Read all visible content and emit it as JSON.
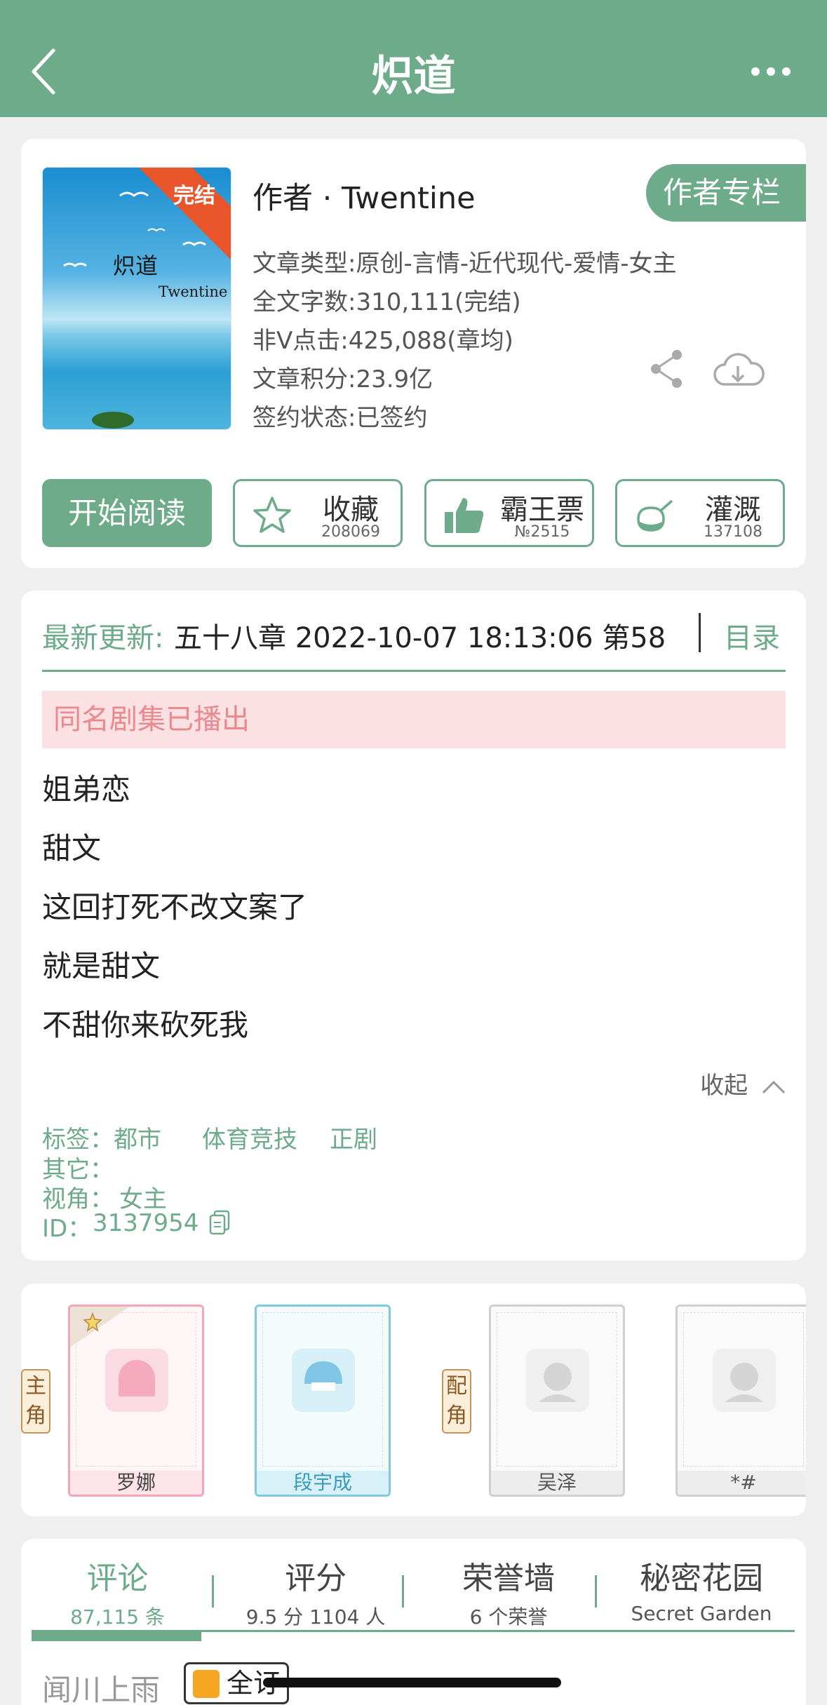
{
  "header": {
    "title": "炽道",
    "back_icon": "chevron-left-icon",
    "more_icon": "more-dots-icon"
  },
  "book": {
    "cover": {
      "title": "炽道",
      "author": "Twentine",
      "ribbon": "完结"
    },
    "author_line": "作者 · Twentine",
    "author_column_btn": "作者专栏",
    "meta": [
      "文章类型:原创-言情-近代现代-爱情-女主",
      "全文字数:310,111(完结)",
      "非Ⅴ点击:425,088(章均)",
      "文章积分:23.9亿",
      "签约状态:已签约"
    ],
    "start_read": "开始阅读",
    "actions": [
      {
        "label": "收藏",
        "count": "208069",
        "icon": "star-outline-icon"
      },
      {
        "label": "霸王票",
        "count": "№2515",
        "icon": "thumbs-up-icon"
      },
      {
        "label": "灌溉",
        "count": "137108",
        "icon": "watering-can-icon"
      }
    ]
  },
  "update": {
    "label": "最新更新:",
    "text": "五十八章 2022-10-07 18:13:06   第58",
    "toc": "目录",
    "notice": "同名剧集已播出",
    "description": [
      "姐弟恋",
      "甜文",
      "这回打死不改文案了",
      "就是甜文",
      "不甜你来砍死我"
    ],
    "collapse": "收起",
    "tags_label": "标签：",
    "tags": [
      "都市",
      "体育竞技",
      "正剧"
    ],
    "other_label": "其它：",
    "view_label": "视角：",
    "view_value": "女主",
    "id_label": "ID：",
    "id_value": "3137954"
  },
  "characters": {
    "main_tag": "主角",
    "support_tag": "配角",
    "list": [
      {
        "name": "罗娜",
        "color": "#f3a6b8"
      },
      {
        "name": "段宇成",
        "color": "#7ecbe0"
      },
      {
        "name": "吴泽",
        "color": "#cfcfcf"
      },
      {
        "name": "*#",
        "color": "#cfcfcf"
      }
    ]
  },
  "tabs": [
    {
      "title": "评论",
      "sub": "87,115 条"
    },
    {
      "title": "评分",
      "sub": "9.5 分 1104 人"
    },
    {
      "title": "荣誉墙",
      "sub": "6 个荣誉"
    },
    {
      "title": "秘密花园",
      "sub": "Secret Garden"
    }
  ],
  "comment_preview": {
    "user": "闻川上雨",
    "badge": "全订"
  },
  "colors": {
    "accent": "#6dab8a",
    "notice_bg": "#fbe1e4",
    "notice_text": "#e98b8d"
  }
}
